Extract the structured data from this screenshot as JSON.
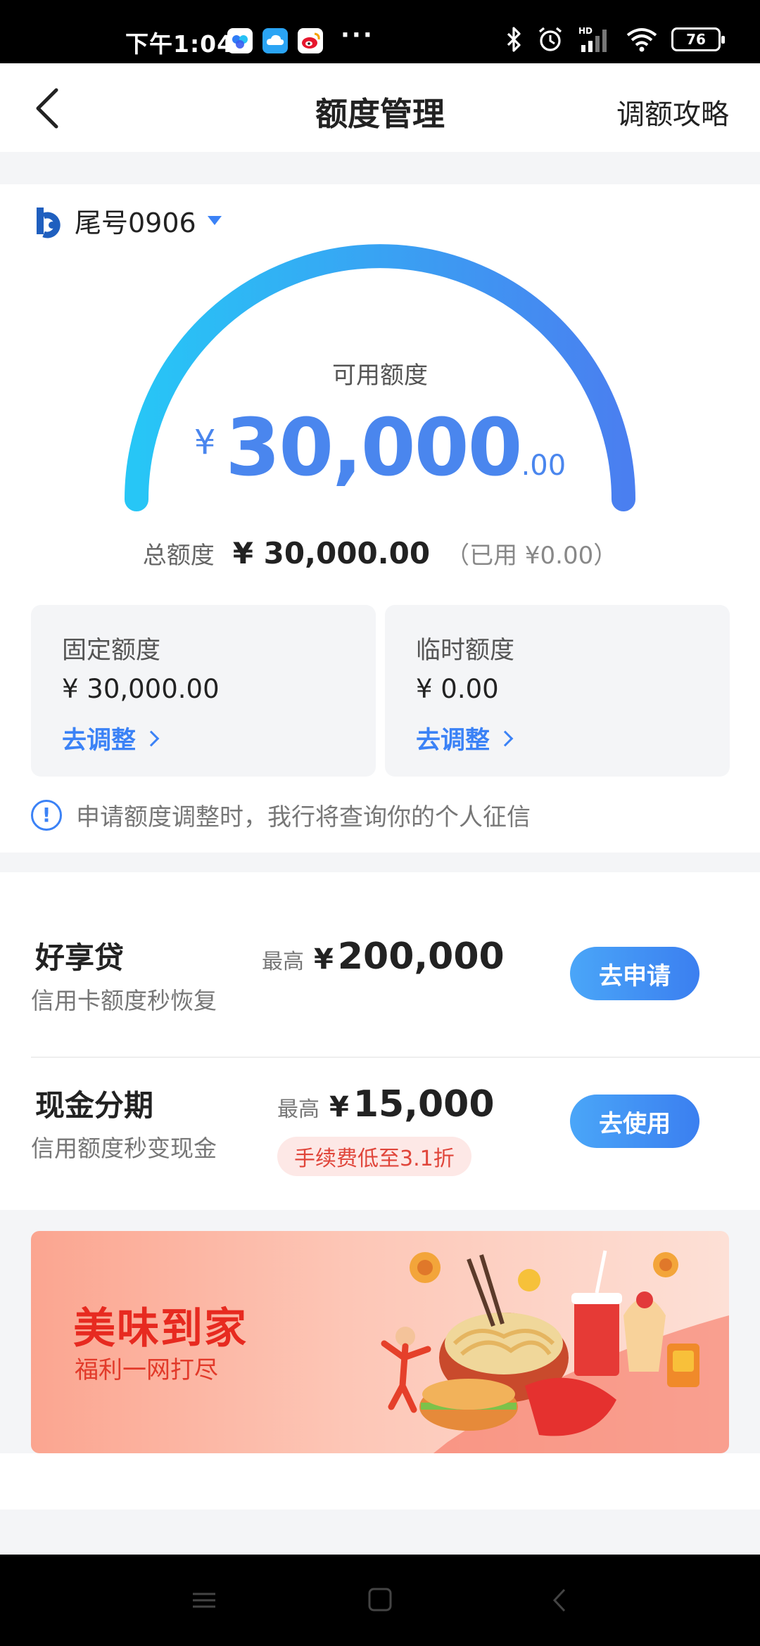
{
  "status_bar": {
    "time": "下午1:04",
    "dots": "···",
    "network": "HD",
    "battery": "76"
  },
  "header": {
    "title": "额度管理",
    "right_link": "调额攻略"
  },
  "card": {
    "label": "尾号0906"
  },
  "limits": {
    "available_label": "可用额度",
    "available_currency": "¥",
    "available_integer": "30,000",
    "available_decimal": ".00",
    "total_label": "总额度",
    "total_value": "¥ 30,000.00",
    "used_text": "（已用 ¥0.00）",
    "usage_fraction": 0
  },
  "quota_boxes": [
    {
      "label": "固定额度",
      "value": "¥ 30,000.00",
      "link": "去调整"
    },
    {
      "label": "临时额度",
      "value": "¥ 0.00",
      "link": "去调整"
    }
  ],
  "notice": {
    "icon": "!",
    "text": "申请额度调整时，我行将查询你的个人征信"
  },
  "loans": [
    {
      "name": "好享贷",
      "desc": "信用卡额度秒恢复",
      "max_label": "最高",
      "currency": "¥",
      "max_value": "200,000",
      "button": "去申请"
    },
    {
      "name": "现金分期",
      "desc": "信用额度秒变现金",
      "max_label": "最高",
      "currency": "¥",
      "max_value": "15,000",
      "tag": "手续费低至3.1折",
      "button": "去使用"
    }
  ],
  "banner": {
    "title": "美味到家",
    "subtitle": "福利一网打尽"
  },
  "colors": {
    "accent": "#3b82f6",
    "amount": "#4a86ee",
    "gauge_start": "#27c6f6",
    "gauge_end": "#4a7ff0",
    "tag_bg": "#fde8e6",
    "tag_text": "#e0453a",
    "banner_title": "#e72a20"
  }
}
